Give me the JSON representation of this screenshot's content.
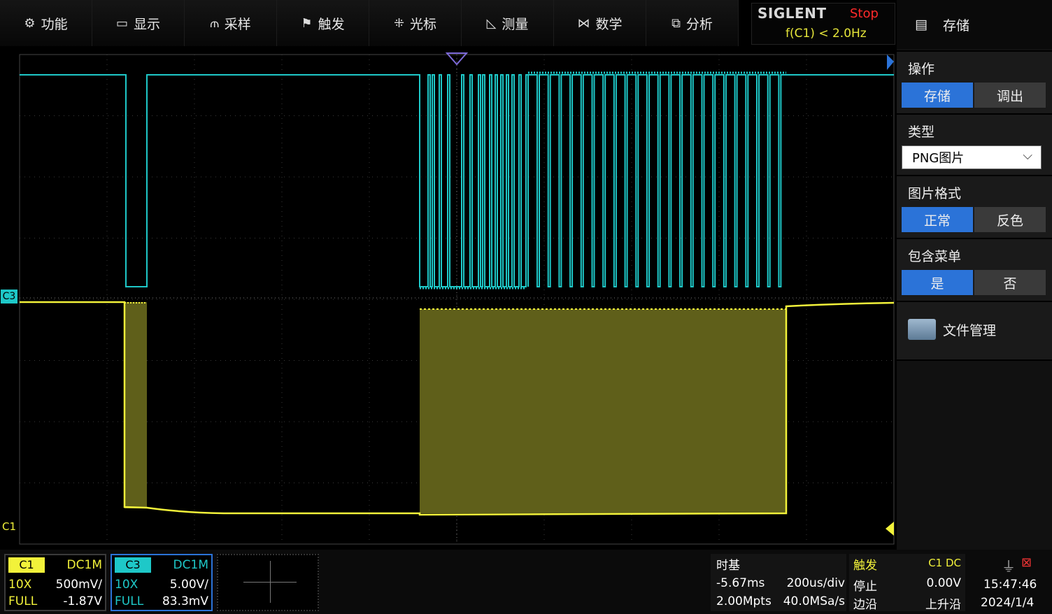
{
  "menu": [
    {
      "label": "功能",
      "icon": "gear-icon",
      "glyph": "⚙"
    },
    {
      "label": "显示",
      "icon": "monitor-icon",
      "glyph": "▭"
    },
    {
      "label": "采样",
      "icon": "sample-icon",
      "glyph": "⫙"
    },
    {
      "label": "触发",
      "icon": "flag-icon",
      "glyph": "⚑"
    },
    {
      "label": "光标",
      "icon": "cursor-icon",
      "glyph": "⁜"
    },
    {
      "label": "测量",
      "icon": "measure-icon",
      "glyph": "◺"
    },
    {
      "label": "数学",
      "icon": "math-icon",
      "glyph": "⋈"
    },
    {
      "label": "分析",
      "icon": "analysis-icon",
      "glyph": "⧉"
    }
  ],
  "brand": {
    "name": "SIGLENT",
    "status": "Stop",
    "freq": "f(C1) < 2.0Hz"
  },
  "panel": {
    "title": "存储",
    "op_title": "操作",
    "op_save": "存储",
    "op_recall": "调出",
    "type_title": "类型",
    "type_value": "PNG图片",
    "fmt_title": "图片格式",
    "fmt_normal": "正常",
    "fmt_invert": "反色",
    "menu_title": "包含菜单",
    "menu_yes": "是",
    "menu_no": "否",
    "file_mgmt": "文件管理"
  },
  "markers": {
    "c3": "C3",
    "c1": "C1"
  },
  "channels": {
    "c1": {
      "name": "C1",
      "coupling": "DC1M",
      "probe": "10X",
      "scale": "500mV/",
      "bw": "FULL",
      "offset": "-1.87V"
    },
    "c3": {
      "name": "C3",
      "coupling": "DC1M",
      "probe": "10X",
      "scale": "5.00V/",
      "bw": "FULL",
      "offset": "83.3mV"
    }
  },
  "timebase": {
    "title": "时基",
    "delay": "-5.67ms",
    "scale": "200us/div",
    "mem": "2.00Mpts",
    "rate": "40.0MSa/s"
  },
  "trigger": {
    "title": "触发",
    "source": "C1 DC",
    "state": "停止",
    "level": "0.00V",
    "type": "边沿",
    "slope": "上升沿"
  },
  "clock": {
    "time": "15:47:46",
    "date": "2024/1/4"
  },
  "colors": {
    "c1": "#f2f23a",
    "c3": "#1ec8c8",
    "c1_fill": "#5f5f1a",
    "accent": "#2b73d8"
  }
}
